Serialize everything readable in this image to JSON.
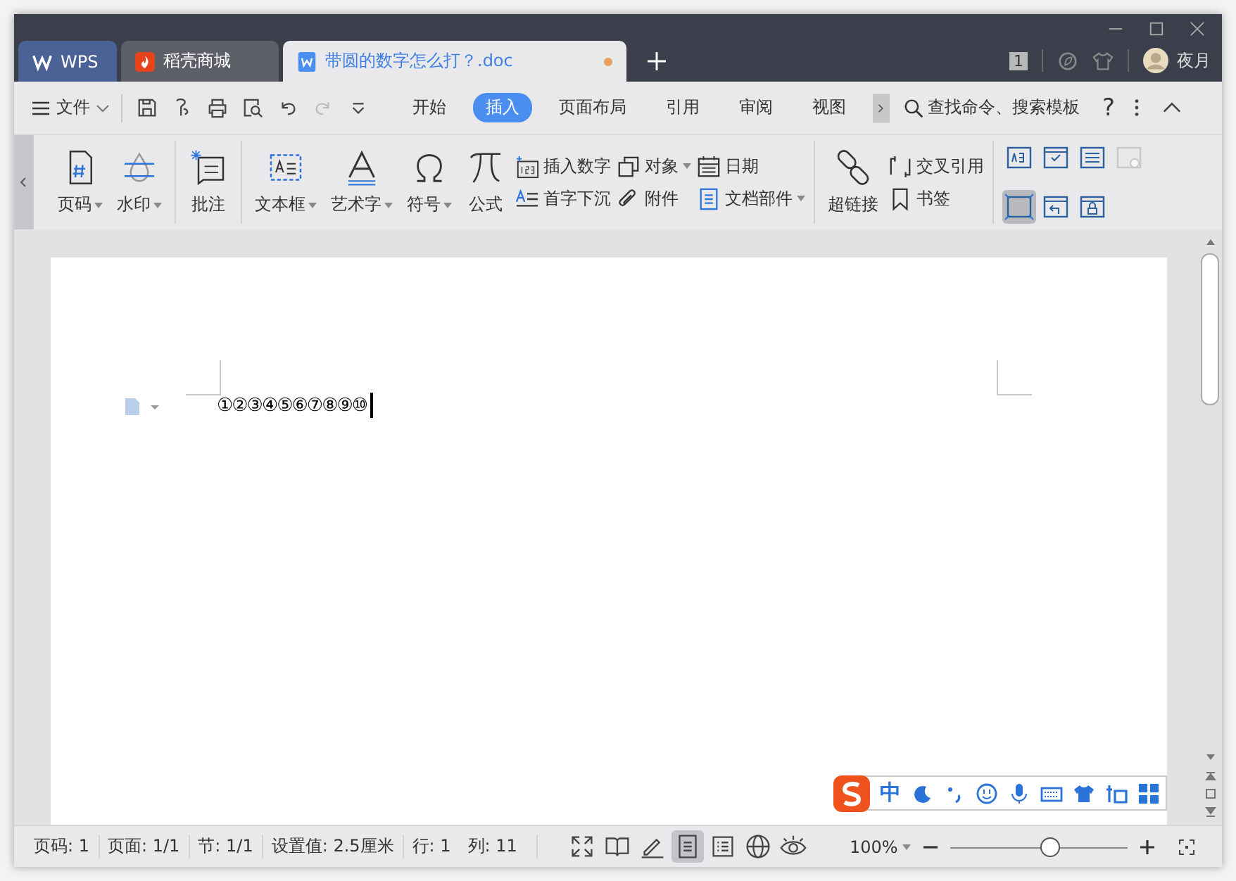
{
  "title_bar": {
    "tabs": [
      {
        "label": "WPS",
        "kind": "wps",
        "selected": false,
        "unsaved": false
      },
      {
        "label": "稻壳商城",
        "kind": "store",
        "selected": false,
        "unsaved": false
      },
      {
        "label": "带圆的数字怎么打？.doc",
        "kind": "doc",
        "selected": true,
        "unsaved": true
      }
    ],
    "window_count": "1",
    "user": "夜月"
  },
  "menu_bar": {
    "file": "文件",
    "tabs": [
      {
        "label": "开始",
        "selected": false
      },
      {
        "label": "插入",
        "selected": true
      },
      {
        "label": "页面布局",
        "selected": false
      },
      {
        "label": "引用",
        "selected": false
      },
      {
        "label": "审阅",
        "selected": false
      },
      {
        "label": "视图",
        "selected": false
      }
    ],
    "search": "查找命令、搜索模板",
    "help": "?"
  },
  "ribbon": {
    "groups": [
      {
        "large": [
          {
            "label": "页码",
            "kind": "page-number",
            "dropdown": true
          },
          {
            "label": "水印",
            "kind": "watermark",
            "dropdown": true
          }
        ]
      },
      {
        "large": [
          {
            "label": "批注",
            "kind": "comment",
            "dropdown": false
          }
        ]
      },
      {
        "large": [
          {
            "label": "文本框",
            "kind": "text-box",
            "dropdown": true
          },
          {
            "label": "艺术字",
            "kind": "art-text",
            "dropdown": true
          },
          {
            "label": "符号",
            "kind": "omega",
            "dropdown": true
          },
          {
            "label": "公式",
            "kind": "pi",
            "dropdown": false
          }
        ],
        "small": [
          {
            "label": "插入数字",
            "kind": "number",
            "dropdown": false
          },
          {
            "label": "首字下沉",
            "kind": "drop-cap",
            "dropdown": false
          },
          {
            "label": "对象",
            "kind": "object",
            "dropdown": true
          },
          {
            "label": "附件",
            "kind": "paperclip",
            "dropdown": false
          },
          {
            "label": "日期",
            "kind": "calendar",
            "dropdown": false
          },
          {
            "label": "文档部件",
            "kind": "document",
            "dropdown": true
          }
        ]
      },
      {
        "large": [
          {
            "label": "超链接",
            "kind": "link",
            "dropdown": false
          }
        ],
        "small": [
          {
            "label": "交叉引用",
            "kind": "brackets",
            "dropdown": false
          },
          {
            "label": "书签",
            "kind": "bookmark",
            "dropdown": false
          }
        ]
      }
    ],
    "controls": [
      {
        "kind": "text-field",
        "selected": false,
        "disabled": false
      },
      {
        "kind": "checkbox",
        "selected": false,
        "disabled": false
      },
      {
        "kind": "list",
        "selected": false,
        "disabled": false
      },
      {
        "kind": "info",
        "selected": false,
        "disabled": true
      },
      {
        "kind": "frame",
        "selected": true,
        "disabled": false
      },
      {
        "kind": "undo",
        "selected": false,
        "disabled": false
      },
      {
        "kind": "lock",
        "selected": false,
        "disabled": false
      }
    ]
  },
  "document": {
    "text": "①②③④⑤⑥⑦⑧⑨⑩"
  },
  "ime": {
    "mode": "中"
  },
  "status_bar": {
    "items": [
      "页码: 1",
      "页面: 1/1",
      "节: 1/1",
      "设置值: 2.5厘米",
      "行: 1",
      "列: 11"
    ],
    "views": [
      {
        "kind": "fullscreen",
        "selected": false
      },
      {
        "kind": "reading",
        "selected": false
      },
      {
        "kind": "edit",
        "selected": false
      },
      {
        "kind": "page",
        "selected": true
      },
      {
        "kind": "outline",
        "selected": false
      },
      {
        "kind": "web",
        "selected": false
      },
      {
        "kind": "eye",
        "selected": false
      }
    ],
    "zoom": "100%",
    "zoom_slider": {
      "level": 0.56
    }
  }
}
